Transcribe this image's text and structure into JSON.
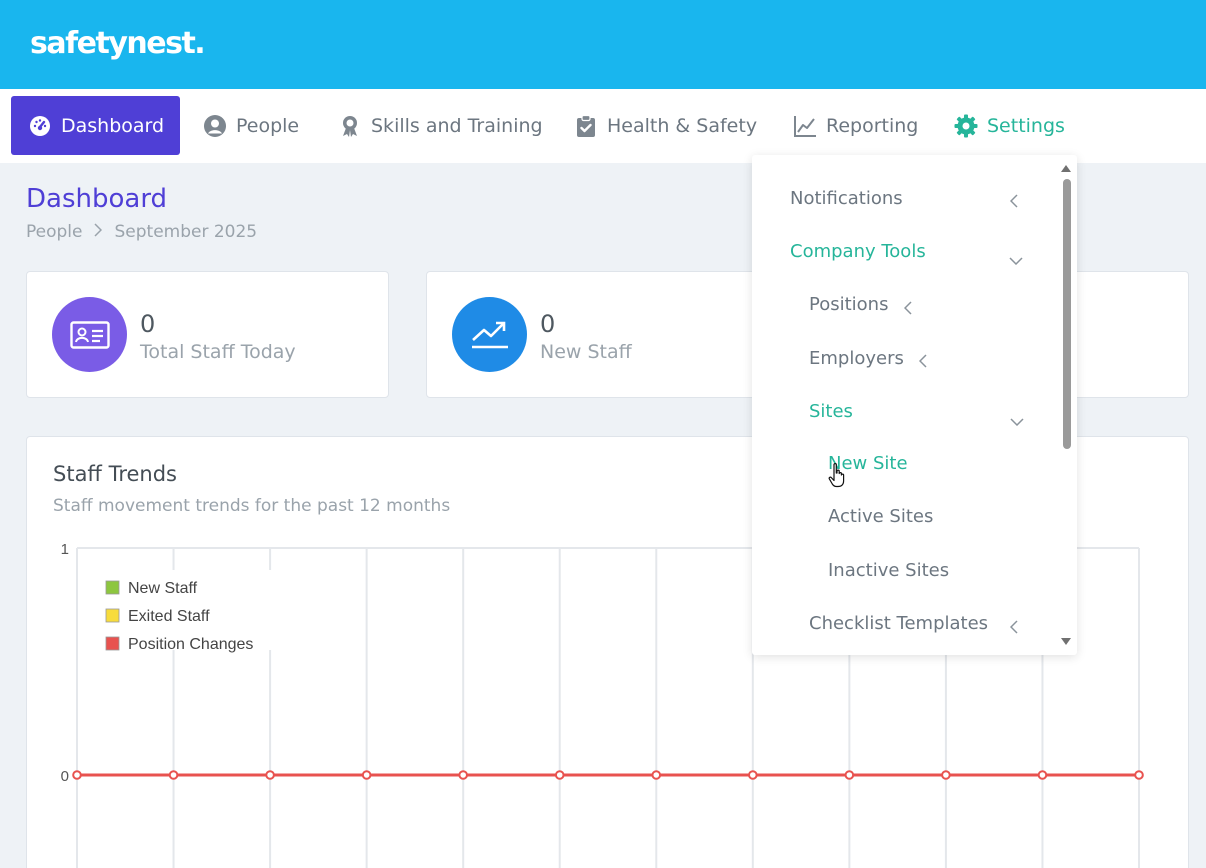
{
  "header": {
    "logo": "safetynest."
  },
  "nav": {
    "items": [
      {
        "label": "Dashboard",
        "icon": "dashboard-gauge-icon"
      },
      {
        "label": "People",
        "icon": "user-circle-icon"
      },
      {
        "label": "Skills and Training",
        "icon": "award-ribbon-icon"
      },
      {
        "label": "Health & Safety",
        "icon": "clipboard-check-icon"
      },
      {
        "label": "Reporting",
        "icon": "line-chart-icon"
      },
      {
        "label": "Settings",
        "icon": "gear-icon"
      }
    ]
  },
  "page": {
    "title": "Dashboard",
    "breadcrumb": [
      "People",
      "September 2025"
    ]
  },
  "stats": [
    {
      "value": "0",
      "label": "Total Staff Today",
      "icon": "id-card-icon",
      "color": "#7a5ce6"
    },
    {
      "value": "0",
      "label": "New Staff",
      "icon": "trending-up-icon",
      "color": "#1f8be6"
    }
  ],
  "trends": {
    "title": "Staff Trends",
    "subtitle": "Staff movement trends for the past 12 months"
  },
  "chart_data": {
    "type": "line",
    "title": "Staff Trends",
    "subtitle": "Staff movement trends for the past 12 months",
    "ylim": [
      0,
      1
    ],
    "y_ticks": [
      "1",
      "0"
    ],
    "grid": true,
    "legend_position": "top-left",
    "categories_count": 12,
    "series": [
      {
        "name": "New Staff",
        "color": "#8dc63f",
        "values": [
          0,
          0,
          0,
          0,
          0,
          0,
          0,
          0,
          0,
          0,
          0,
          0
        ]
      },
      {
        "name": "Exited Staff",
        "color": "#f7dc3c",
        "values": [
          0,
          0,
          0,
          0,
          0,
          0,
          0,
          0,
          0,
          0,
          0,
          0
        ]
      },
      {
        "name": "Position Changes",
        "color": "#e8524f",
        "values": [
          0,
          0,
          0,
          0,
          0,
          0,
          0,
          0,
          0,
          0,
          0,
          0
        ]
      }
    ]
  },
  "settings_menu": {
    "items": [
      {
        "label": "Notifications",
        "state": "collapsed"
      },
      {
        "label": "Company Tools",
        "state": "expanded",
        "active": true
      },
      {
        "label": "Positions",
        "state": "collapsed"
      },
      {
        "label": "Employers",
        "state": "collapsed"
      },
      {
        "label": "Sites",
        "state": "expanded",
        "active": true
      },
      {
        "label": "New Site",
        "hovered": true
      },
      {
        "label": "Active Sites"
      },
      {
        "label": "Inactive Sites"
      },
      {
        "label": "Checklist Templates",
        "state": "collapsed"
      }
    ]
  },
  "colors": {
    "topbar": "#19b6ee",
    "active_nav": "#4f3fd6",
    "teal_accent": "#26b59a"
  }
}
